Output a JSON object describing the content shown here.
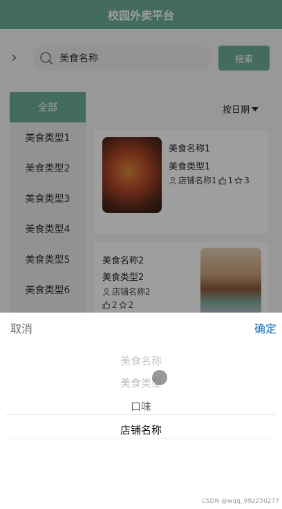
{
  "header": {
    "title": "校园外卖平台"
  },
  "search": {
    "value": "美食名称",
    "button_label": "搜索"
  },
  "sidebar": {
    "items": [
      {
        "label": "全部",
        "active": true
      },
      {
        "label": "美食类型1"
      },
      {
        "label": "美食类型2"
      },
      {
        "label": "美食类型3"
      },
      {
        "label": "美食类型4"
      },
      {
        "label": "美食类型5"
      },
      {
        "label": "美食类型6"
      }
    ]
  },
  "sort": {
    "label": "按日期"
  },
  "cards": [
    {
      "name": "美食名称1",
      "type": "美食类型1",
      "shop": "店铺名称1",
      "likes": "1",
      "stars": "3",
      "image": "fried-dish-photo"
    },
    {
      "name": "美食名称2",
      "type": "美食类型2",
      "shop": "店铺名称2",
      "likes": "2",
      "stars": "2",
      "image": "burger-photo"
    }
  ],
  "picker": {
    "cancel_label": "取消",
    "confirm_label": "确定",
    "options": [
      "美食名称",
      "美食类型",
      "口味",
      "店铺名称"
    ],
    "selected": "店铺名称"
  },
  "watermark": "CSDN @wqq_992250277",
  "colors": {
    "accent": "#6fae97",
    "confirm": "#1a6fbf"
  }
}
